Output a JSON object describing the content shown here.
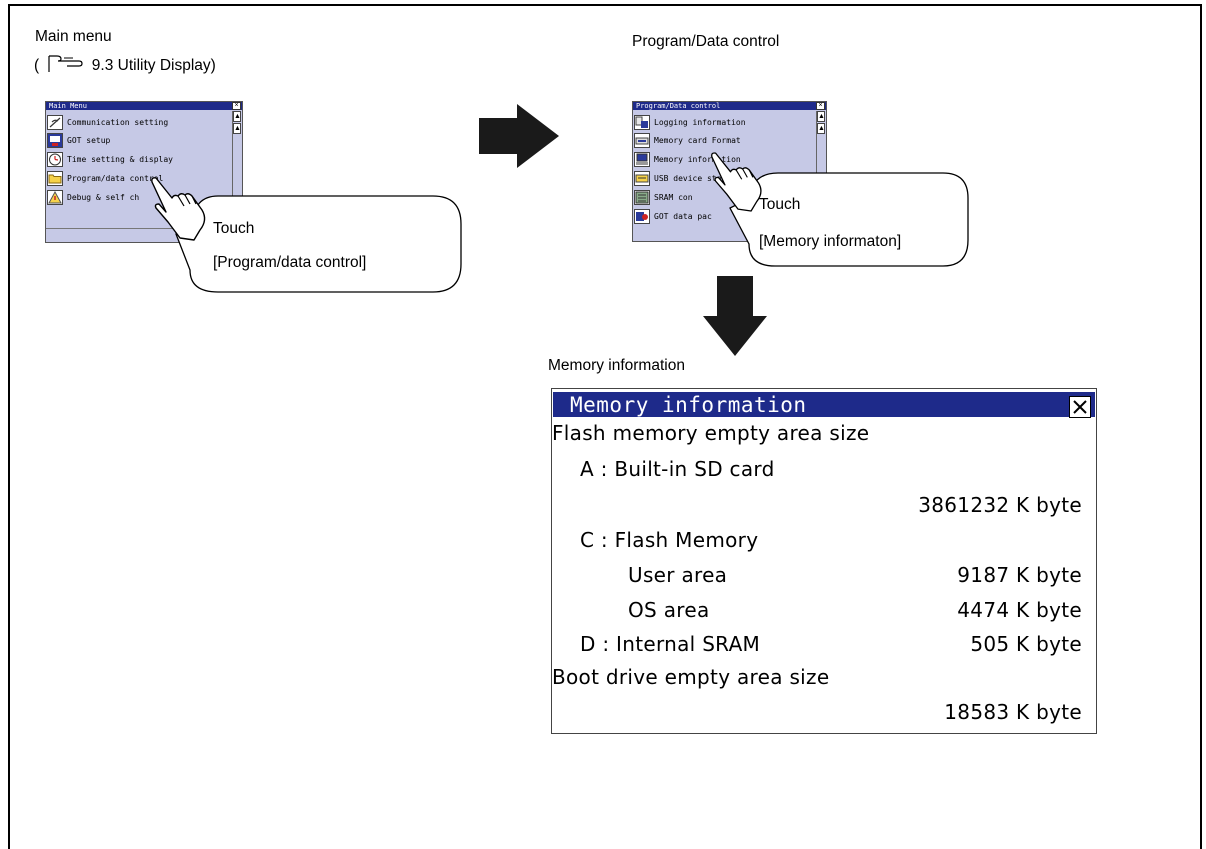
{
  "main_menu": {
    "caption": "Main menu",
    "reference_open": "(",
    "reference_text": "9.3 Utility Display)",
    "screen_title": "Main Menu",
    "items": [
      {
        "label": "Communication setting",
        "icon": "communication-icon"
      },
      {
        "label": "GOT setup",
        "icon": "got-setup-icon"
      },
      {
        "label": "Time setting & display",
        "icon": "clock-icon"
      },
      {
        "label": "Program/data control",
        "icon": "folder-icon"
      },
      {
        "label": "Debug & self ch",
        "icon": "debug-icon"
      }
    ],
    "callout_line1": "Touch",
    "callout_line2": "[Program/data control]"
  },
  "program_data": {
    "caption": "Program/Data control",
    "screen_title": "Program/Data control",
    "items": [
      {
        "label": "Logging information",
        "icon": "logging-icon"
      },
      {
        "label": "Memory card Format",
        "icon": "memory-card-icon"
      },
      {
        "label": "Memory information",
        "icon": "memory-info-icon"
      },
      {
        "label": "USB device status d",
        "icon": "usb-icon"
      },
      {
        "label": "SRAM con",
        "icon": "sram-icon"
      },
      {
        "label": "GOT data pac",
        "icon": "got-data-icon"
      }
    ],
    "callout_line1": "Touch",
    "callout_line2": "[Memory informaton]"
  },
  "memory_info": {
    "caption": "Memory information",
    "title": "Memory information",
    "flash_heading": "Flash memory empty area size",
    "a_label": "A : Built-in SD card",
    "a_value": "3861232 K byte",
    "c_label": "C : Flash Memory",
    "user_area_label": "User area",
    "user_area_value": "9187 K byte",
    "os_area_label": "OS area",
    "os_area_value": "4474 K byte",
    "d_label": "D : Internal SRAM",
    "d_value": "505 K byte",
    "boot_heading": "Boot drive empty area size",
    "boot_value": "18583 K byte"
  },
  "colors": {
    "title_bar": "#1e2a8a",
    "screen_bg": "#c6c9e6"
  }
}
